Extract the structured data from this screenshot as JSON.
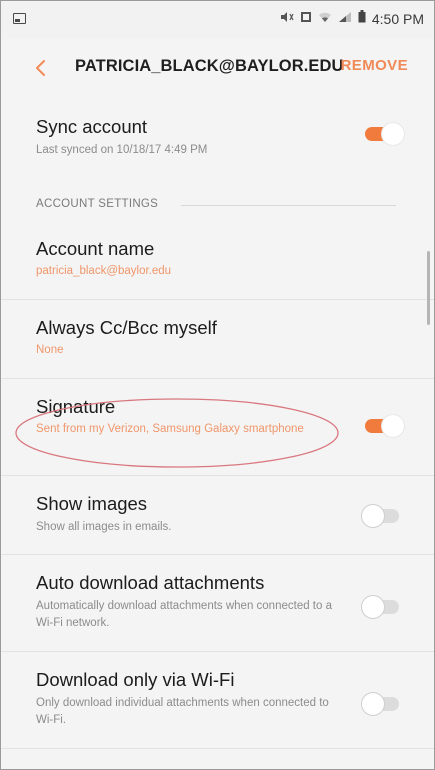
{
  "status_bar": {
    "time": "4:50 PM"
  },
  "header": {
    "title": "PATRICIA_BLACK@BAYLOR.EDU",
    "remove_label": "REMOVE"
  },
  "settings": {
    "sync_account": {
      "title": "Sync account",
      "subtitle": "Last synced on 10/18/17  4:49 PM",
      "enabled": true
    },
    "section_header": "ACCOUNT SETTINGS",
    "account_name": {
      "title": "Account name",
      "value": "patricia_black@baylor.edu"
    },
    "always_cc": {
      "title": "Always Cc/Bcc myself",
      "value": "None"
    },
    "signature": {
      "title": "Signature",
      "value": "Sent from my Verizon, Samsung Galaxy smartphone",
      "enabled": true
    },
    "show_images": {
      "title": "Show images",
      "subtitle": "Show all images in emails.",
      "enabled": false
    },
    "auto_download": {
      "title": "Auto download attachments",
      "subtitle": "Automatically download attachments when connected to a Wi-Fi network.",
      "enabled": false
    },
    "download_wifi": {
      "title": "Download only via Wi-Fi",
      "subtitle": "Only download individual attachments when connected to Wi-Fi.",
      "enabled": false
    }
  },
  "colors": {
    "accent": "#f07b3d",
    "highlight_circle": "#d9777f"
  }
}
